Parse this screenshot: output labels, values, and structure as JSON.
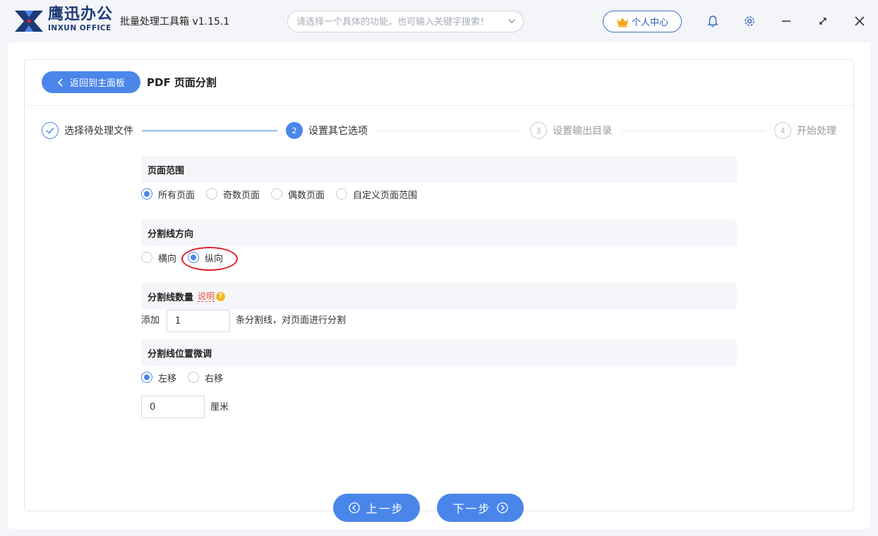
{
  "app": {
    "brand_cn": "鹰迅办公",
    "brand_en": "INXUN OFFICE",
    "title": "批量处理工具箱 v1.15.1",
    "search_placeholder": "请选择一个具体的功能，也可输入关键字搜索！",
    "user_center": "个人中心",
    "accent_color": "#4a86ea",
    "icons": [
      "crown-icon",
      "bell-icon",
      "gear-icon",
      "minimize-icon",
      "maximize-icon",
      "close-icon"
    ]
  },
  "header": {
    "back_label": "返回到主面板",
    "page_title": "PDF 页面分割"
  },
  "steps": [
    {
      "num": "",
      "label": "选择待处理文件",
      "state": "done"
    },
    {
      "num": "2",
      "label": "设置其它选项",
      "state": "active"
    },
    {
      "num": "3",
      "label": "设置输出目录",
      "state": "todo"
    },
    {
      "num": "4",
      "label": "开始处理",
      "state": "todo"
    }
  ],
  "page_range": {
    "title": "页面范围",
    "options": [
      "所有页面",
      "奇数页面",
      "偶数页面",
      "自定义页面范围"
    ],
    "selected": "所有页面"
  },
  "direction": {
    "title": "分割线方向",
    "options": [
      "横向",
      "纵向"
    ],
    "selected": "纵向"
  },
  "line_count": {
    "title": "分割线数量",
    "hint": "说明",
    "hint_icon": "?",
    "prefix": "添加",
    "value": "1",
    "suffix": "条分割线，对页面进行分割"
  },
  "fine_tune": {
    "title": "分割线位置微调",
    "options": [
      "左移",
      "右移"
    ],
    "selected": "左移",
    "value": "0",
    "unit": "厘米"
  },
  "nav": {
    "prev": "上一步",
    "next": "下一步"
  }
}
